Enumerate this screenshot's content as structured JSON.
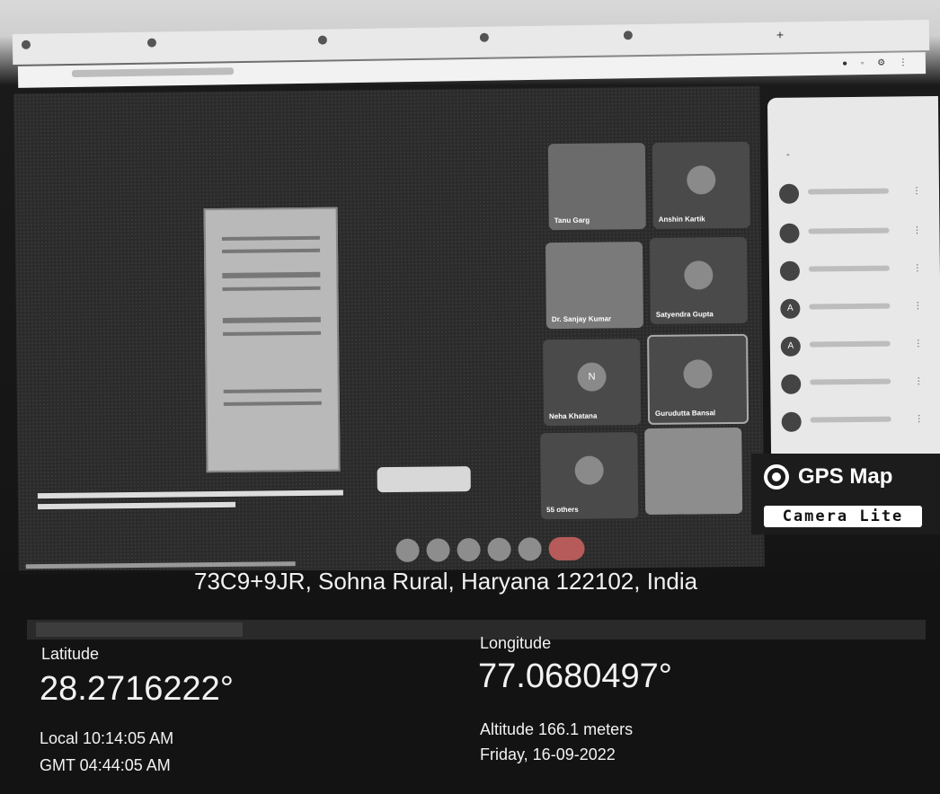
{
  "meet": {
    "participants": [
      {
        "name": "Tanu Garg"
      },
      {
        "name": "Anshin Kartik"
      },
      {
        "name": "Dr. Sanjay Kumar"
      },
      {
        "name": "Satyendra Gupta"
      },
      {
        "name": "Neha Khatana",
        "initial": "N"
      },
      {
        "name": "Gurudutta Bansal"
      },
      {
        "name": "55 others"
      },
      {
        "name": ""
      }
    ],
    "people_rows": [
      {
        "initial": ""
      },
      {
        "initial": ""
      },
      {
        "initial": ""
      },
      {
        "initial": "A"
      },
      {
        "initial": "A"
      },
      {
        "initial": ""
      },
      {
        "initial": ""
      }
    ]
  },
  "gps_badge": {
    "title": "GPS Map",
    "subtitle": "Camera Lite"
  },
  "location": {
    "address": "73C9+9JR, Sohna Rural, Haryana 122102, India",
    "latitude_label": "Latitude",
    "latitude": "28.2716222°",
    "longitude_label": "Longitude",
    "longitude": "77.0680497°",
    "local_time": "Local 10:14:05 AM",
    "gmt_time": "GMT 04:44:05 AM",
    "altitude": "Altitude 166.1 meters",
    "date": "Friday, 16-09-2022"
  }
}
